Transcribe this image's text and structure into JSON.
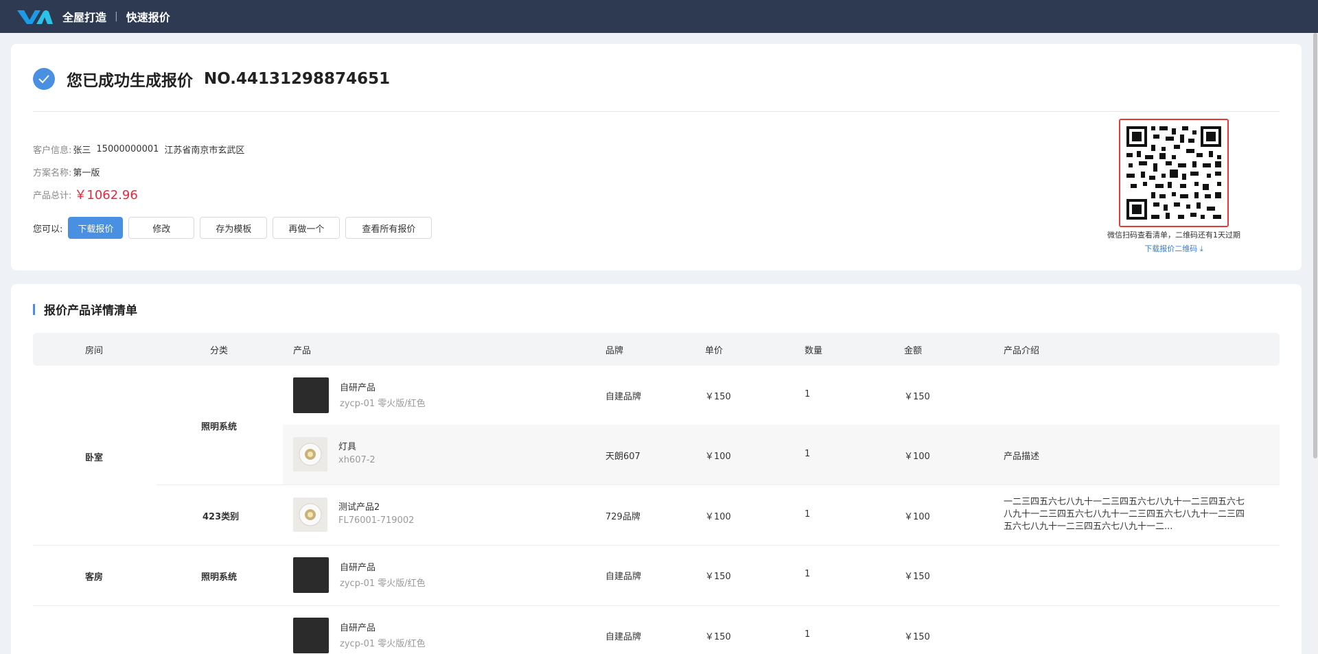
{
  "header": {
    "brand": "全屋打造",
    "separator": "|",
    "subtitle": "快速报价"
  },
  "success": {
    "title": "您已成功生成报价",
    "order_no": "NO.44131298874651"
  },
  "customer": {
    "label": "客户信息:",
    "name": "张三",
    "phone": "15000000001",
    "address": "江苏省南京市玄武区"
  },
  "plan": {
    "label": "方案名称:",
    "value": "第一版"
  },
  "total": {
    "label": "产品总计:",
    "value": "￥1062.96"
  },
  "actions": {
    "label": "您可以:",
    "download": "下载报价",
    "edit": "修改",
    "save_template": "存为模板",
    "redo": "再做一个",
    "view_all": "查看所有报价"
  },
  "qr": {
    "note": "微信扫码查看清单，二维码还有1天过期",
    "download": "下载报价二维码"
  },
  "list": {
    "title": "报价产品详情清单",
    "columns": {
      "room": "房间",
      "category": "分类",
      "product": "产品",
      "brand": "品牌",
      "unit_price": "单价",
      "qty": "数量",
      "amount": "金额",
      "intro": "产品介绍"
    },
    "rows": [
      {
        "room": "卧室",
        "category": "照明系统",
        "name": "自研产品",
        "code": "zycp-01 零火版/红色",
        "brand": "自建品牌",
        "price": "￥150",
        "qty": "1",
        "amount": "￥150",
        "intro": ""
      },
      {
        "room": "",
        "category": "",
        "name": "灯具",
        "code": "xh607-2",
        "brand": "天朗607",
        "price": "￥100",
        "qty": "1",
        "amount": "￥100",
        "intro": "产品描述"
      },
      {
        "room": "",
        "category": "423类别",
        "name": "测试产品2",
        "code": "FL76001-719002",
        "brand": "729品牌",
        "price": "￥100",
        "qty": "1",
        "amount": "￥100",
        "intro": "一二三四五六七八九十一二三四五六七八九十一二三四五六七八九十一二三四五六七八九十一二三四五六七八九十一二三四五六七八九十一二三四五六七八九十一二..."
      },
      {
        "room": "客房",
        "category": "照明系统",
        "name": "自研产品",
        "code": "zycp-01 零火版/红色",
        "brand": "自建品牌",
        "price": "￥150",
        "qty": "1",
        "amount": "￥150",
        "intro": ""
      },
      {
        "room": "",
        "category": "",
        "name": "自研产品",
        "code": "zycp-01 零火版/红色",
        "brand": "自建品牌",
        "price": "￥150",
        "qty": "1",
        "amount": "￥150",
        "intro": ""
      }
    ]
  },
  "colors": {
    "topbar": "#2e3a52",
    "accent": "#4a90e2",
    "price_red": "#e8273b",
    "qr_border": "#e53935"
  }
}
